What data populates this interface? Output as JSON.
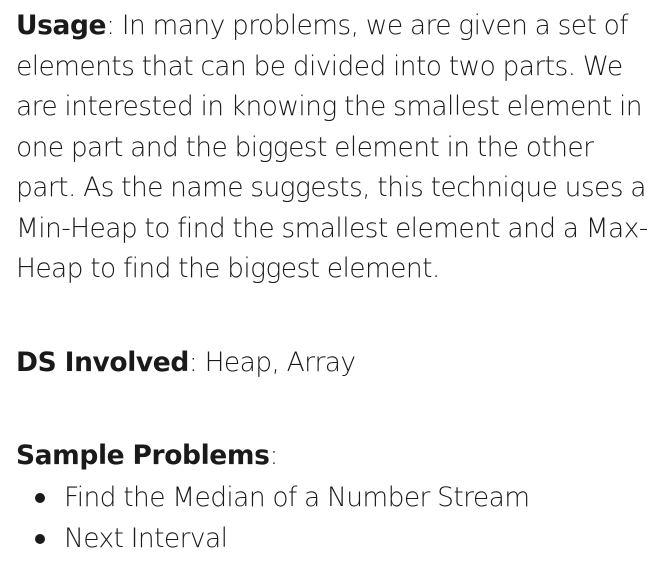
{
  "usage": {
    "label": "Usage",
    "separator": ":",
    "text": " In many problems, we are given a set of elements that can be divided into two parts. We are interested in knowing the smallest element in one part and the biggest element in the other part. As the name suggests, this technique uses a Min-Heap to find the smallest element and a Max-Heap to find the biggest element."
  },
  "ds_involved": {
    "label": "DS Involved",
    "separator": ":",
    "text": " Heap, Array"
  },
  "sample_problems": {
    "label": "Sample Problems",
    "separator": ":",
    "items": [
      "Find the Median of a Number Stream",
      "Next Interval"
    ]
  }
}
